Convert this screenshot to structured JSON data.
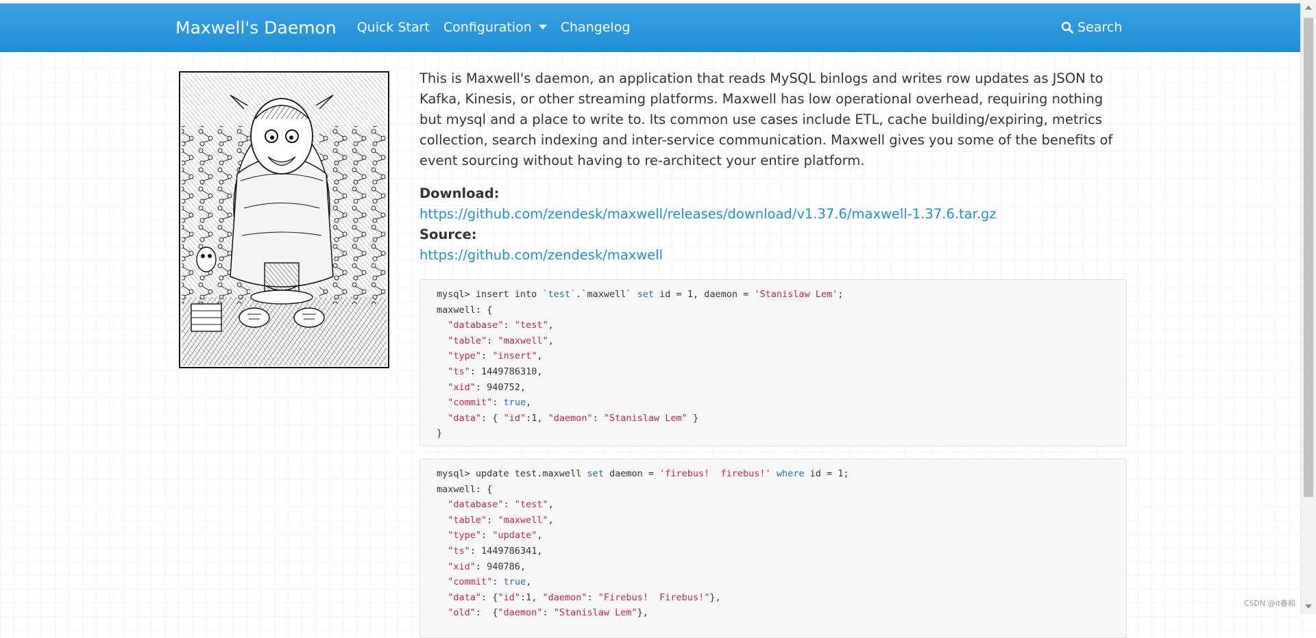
{
  "navbar": {
    "brand": "Maxwell's Daemon",
    "links": [
      "Quick Start",
      "Configuration",
      "Changelog"
    ],
    "search_label": "Search"
  },
  "colors": {
    "navbar": "#2a97dd",
    "link": "#1e8fd6",
    "code_string": "#c7254e",
    "code_keyword": "#1e6fb6"
  },
  "illustration": {
    "description_icon": "daemon-illustration"
  },
  "intro": "This is Maxwell's daemon, an application that reads MySQL binlogs and writes row updates as JSON to Kafka, Kinesis, or other streaming platforms. Maxwell has low operational overhead, requiring nothing but mysql and a place to write to. Its common use cases include ETL, cache building/expiring, metrics collection, search indexing and inter-service communication. Maxwell gives you some of the benefits of event sourcing without having to re-architect your entire platform.",
  "download": {
    "label": "Download:",
    "url": "https://github.com/zendesk/maxwell/releases/download/v1.37.6/maxwell-1.37.6.tar.gz"
  },
  "source": {
    "label": "Source:",
    "url": "https://github.com/zendesk/maxwell"
  },
  "code1": {
    "prompt": "mysql> insert into ",
    "tbl1": "`test`",
    "dot": ".",
    "tbl2": "`maxwell`",
    "set": "set",
    "rest": " id = 1, daemon = ",
    "val": "'Stanislaw Lem'",
    "semi": ";",
    "lines": [
      {
        "k": "\"database\"",
        "v": "\"test\"",
        "t": "str"
      },
      {
        "k": "\"table\"",
        "v": "\"maxwell\"",
        "t": "str"
      },
      {
        "k": "\"type\"",
        "v": "\"insert\"",
        "t": "str"
      },
      {
        "k": "\"ts\"",
        "v": "1449786310",
        "t": "num"
      },
      {
        "k": "\"xid\"",
        "v": "940752",
        "t": "num"
      },
      {
        "k": "\"commit\"",
        "v": "true",
        "t": "bool"
      }
    ],
    "data_line": {
      "k": "\"data\"",
      "open": ": { ",
      "id_k": "\"id\"",
      "id_v": ":1, ",
      "d_k": "\"daemon\"",
      "sep": ": ",
      "d_v": "\"Stanislaw Lem\"",
      "close": " }"
    }
  },
  "code2": {
    "prompt": "mysql> update test.maxwell ",
    "set": "set",
    "mid": " daemon = ",
    "val": "'firebus!  firebus!'",
    "where": "where",
    "rest": " id = 1;",
    "lines": [
      {
        "k": "\"database\"",
        "v": "\"test\"",
        "t": "str"
      },
      {
        "k": "\"table\"",
        "v": "\"maxwell\"",
        "t": "str"
      },
      {
        "k": "\"type\"",
        "v": "\"update\"",
        "t": "str"
      },
      {
        "k": "\"ts\"",
        "v": "1449786341",
        "t": "num"
      },
      {
        "k": "\"xid\"",
        "v": "940786",
        "t": "num"
      },
      {
        "k": "\"commit\"",
        "v": "true",
        "t": "bool"
      }
    ],
    "data_line": {
      "k": "\"data\"",
      "open": ": {",
      "id_k": "\"id\"",
      "id_v": ":1, ",
      "d_k": "\"daemon\"",
      "sep": ": ",
      "d_v": "\"Firebus!  Firebus!\"",
      "close": "},"
    },
    "old_line": {
      "k": "\"old\"",
      "open": ":  {",
      "d_k": "\"daemon\"",
      "sep": ": ",
      "d_v": "\"Stanislaw Lem\"",
      "close": "},"
    }
  },
  "maxwell_open": "maxwell: {",
  "close_brace": "}",
  "watermark": "CSDN @it春和"
}
